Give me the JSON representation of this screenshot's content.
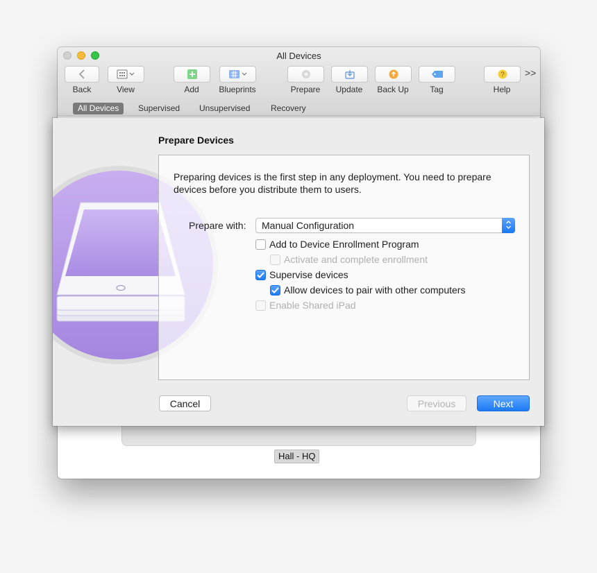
{
  "window": {
    "title": "All Devices"
  },
  "toolbar": {
    "back": "Back",
    "view": "View",
    "add": "Add",
    "blueprints": "Blueprints",
    "prepare": "Prepare",
    "update": "Update",
    "backup": "Back Up",
    "tag": "Tag",
    "help": "Help",
    "more": ">>"
  },
  "scope_tabs": [
    "All Devices",
    "Supervised",
    "Unsupervised",
    "Recovery"
  ],
  "background": {
    "device_tag": "Hall - HQ"
  },
  "sheet": {
    "title": "Prepare Devices",
    "intro": "Preparing devices is the first step in any deployment. You need to prepare devices before you distribute them to users.",
    "prepare_with_label": "Prepare with:",
    "prepare_with_value": "Manual Configuration",
    "options": [
      {
        "label": "Add to Device Enrollment Program",
        "checked": false,
        "enabled": true
      },
      {
        "label": "Activate and complete enrollment",
        "checked": false,
        "enabled": false
      },
      {
        "label": "Supervise devices",
        "checked": true,
        "enabled": true
      },
      {
        "label": "Allow devices to pair with other computers",
        "checked": true,
        "enabled": true
      },
      {
        "label": "Enable Shared iPad",
        "checked": false,
        "enabled": false
      }
    ],
    "buttons": {
      "cancel": "Cancel",
      "previous": "Previous",
      "next": "Next"
    }
  },
  "colors": {
    "accent": "#1a78f2",
    "art_purple": "#b99be8"
  }
}
